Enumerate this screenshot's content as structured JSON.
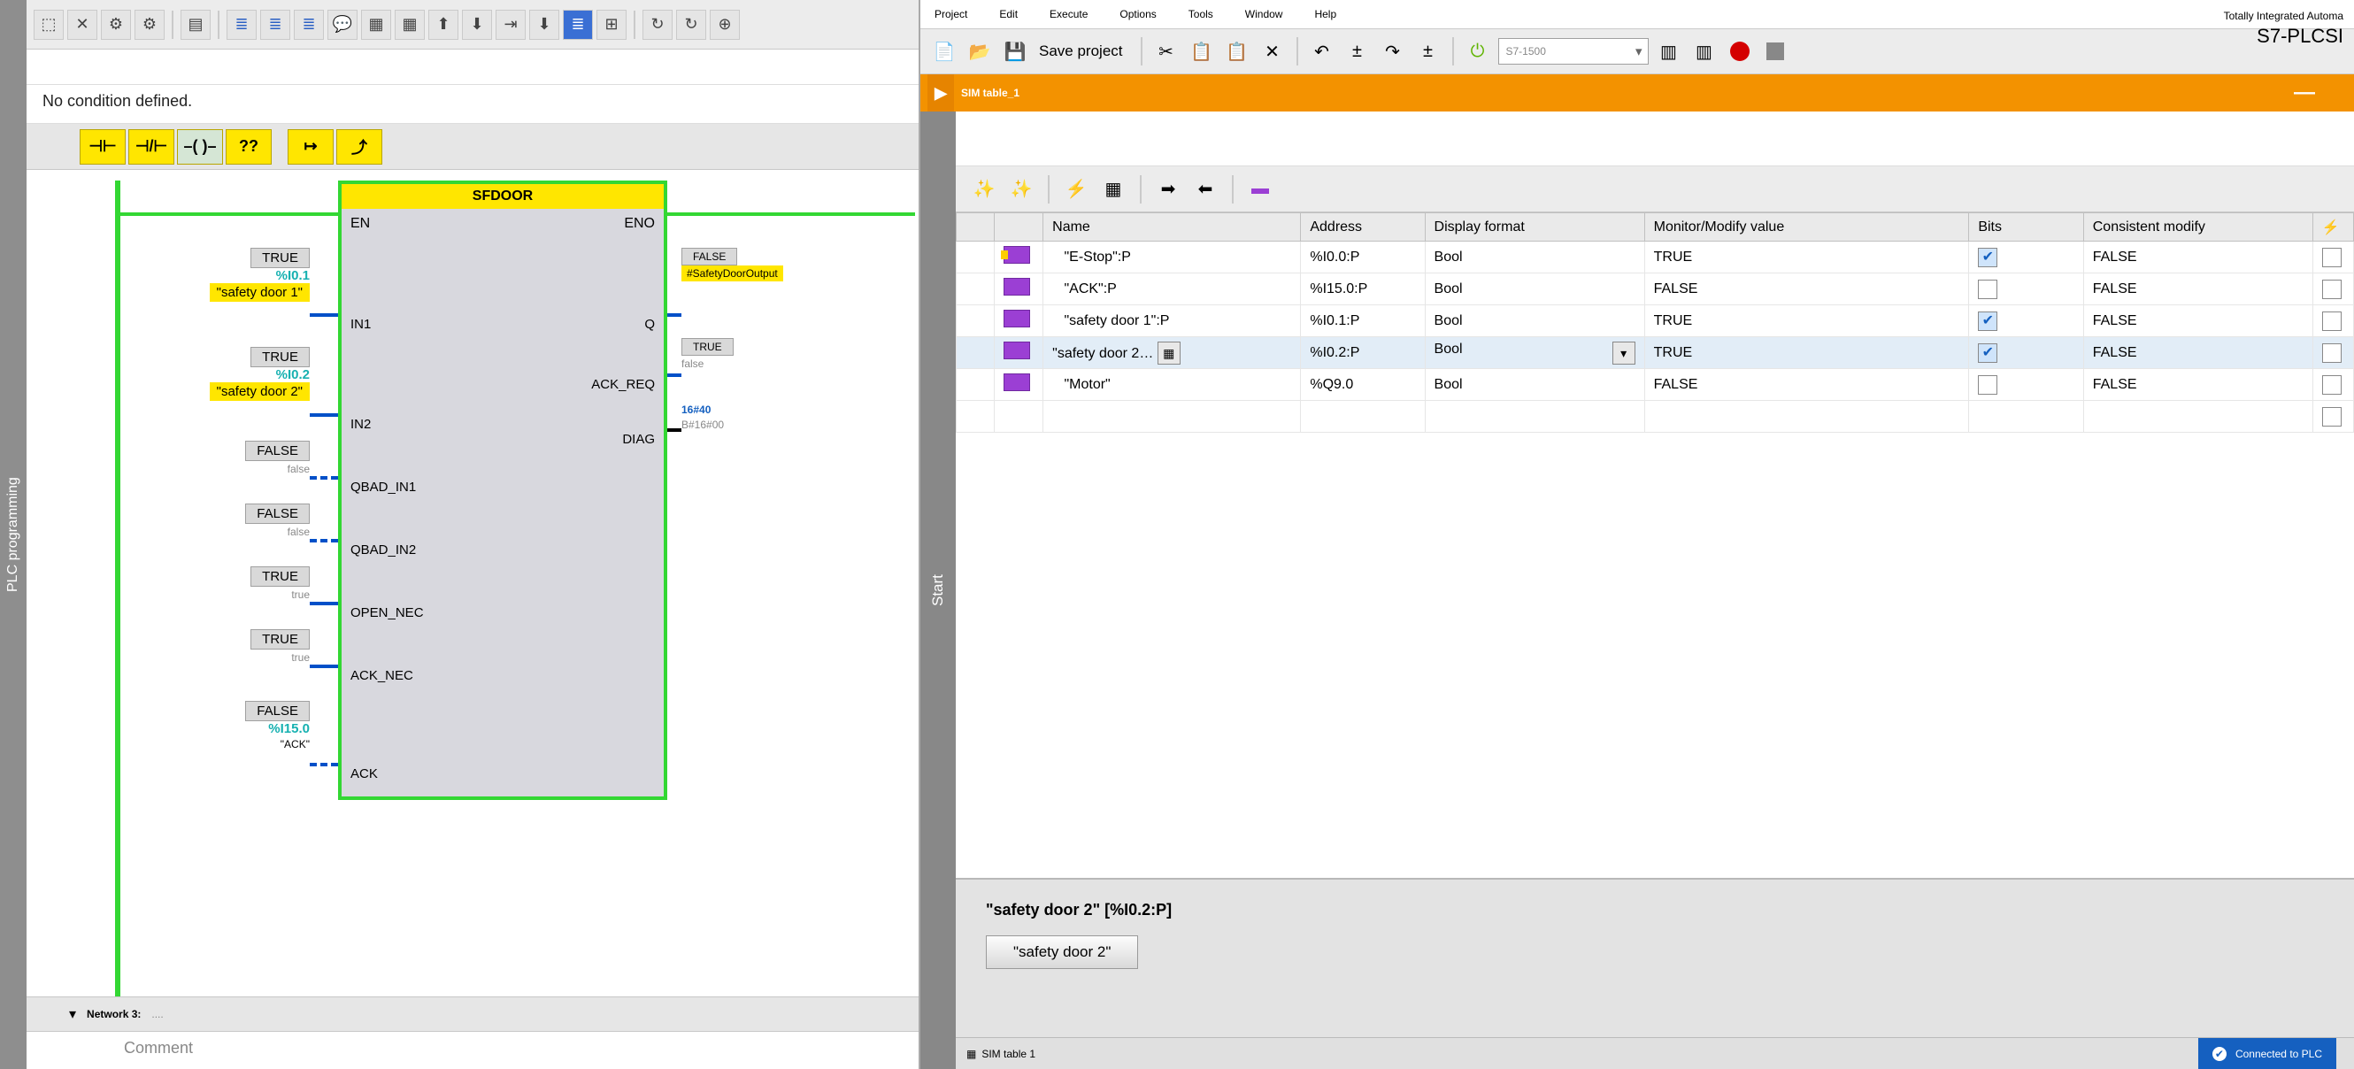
{
  "plc_tab": "PLC programming",
  "condition_text": "No condition defined.",
  "ladder_buttons": [
    "⊣⊢",
    "⊣/⊢",
    "–( )–",
    "??",
    "↦",
    "⤴"
  ],
  "block": {
    "title": "SFDOOR",
    "en": "EN",
    "eno": "ENO",
    "inputs": [
      "IN1",
      "IN2",
      "QBAD_IN1",
      "QBAD_IN2",
      "OPEN_NEC",
      "ACK_NEC",
      "ACK"
    ],
    "outputs": [
      "Q",
      "ACK_REQ",
      "DIAG"
    ]
  },
  "input_tags": [
    {
      "val": "TRUE",
      "addr": "%I0.1",
      "name": "\"safety door 1\""
    },
    {
      "val": "TRUE",
      "addr": "%I0.2",
      "name": "\"safety door 2\""
    },
    {
      "val": "FALSE",
      "addr": "",
      "name": "false"
    },
    {
      "val": "FALSE",
      "addr": "",
      "name": "false"
    },
    {
      "val": "TRUE",
      "addr": "",
      "name": "true"
    },
    {
      "val": "TRUE",
      "addr": "",
      "name": "true"
    },
    {
      "val": "FALSE",
      "addr": "%I15.0",
      "name": "\"ACK\""
    }
  ],
  "output_tags": [
    {
      "val": "FALSE",
      "name": "#SafetyDoorOutput"
    },
    {
      "val": "TRUE",
      "name": "false"
    },
    {
      "val": "16#40",
      "name": "B#16#00"
    }
  ],
  "network3_label": "Network 3:",
  "network3_dots": "....",
  "comment_label": "Comment",
  "menu": [
    "Project",
    "Edit",
    "Execute",
    "Options",
    "Tools",
    "Window",
    "Help"
  ],
  "app_title": "Totally Integrated Automa",
  "app_sub": "S7-PLCSI",
  "save_label": "Save project",
  "device": "S7-1500",
  "sim_title": "SIM table_1",
  "start_tab": "Start",
  "columns": [
    "",
    "",
    "Name",
    "Address",
    "Display format",
    "Monitor/Modify value",
    "Bits",
    "Consistent modify",
    ""
  ],
  "rows": [
    {
      "name": "\"E-Stop\":P",
      "addr": "%I0.0:P",
      "fmt": "Bool",
      "mon": "TRUE",
      "chk": true,
      "cons": "FALSE"
    },
    {
      "name": "\"ACK\":P",
      "addr": "%I15.0:P",
      "fmt": "Bool",
      "mon": "FALSE",
      "chk": false,
      "cons": "FALSE"
    },
    {
      "name": "\"safety door 1\":P",
      "addr": "%I0.1:P",
      "fmt": "Bool",
      "mon": "TRUE",
      "chk": true,
      "cons": "FALSE"
    },
    {
      "name": "\"safety door 2…",
      "addr": "%I0.2:P",
      "fmt": "Bool",
      "mon": "TRUE",
      "chk": true,
      "cons": "FALSE",
      "sel": true
    },
    {
      "name": "\"Motor\"",
      "addr": "%Q9.0",
      "fmt": "Bool",
      "mon": "FALSE",
      "chk": false,
      "cons": "FALSE"
    }
  ],
  "detail_title": "\"safety door 2\" [%I0.2:P]",
  "detail_btn": "\"safety door 2\"",
  "status_tab": "SIM table 1",
  "status_conn": "Connected to PLC"
}
